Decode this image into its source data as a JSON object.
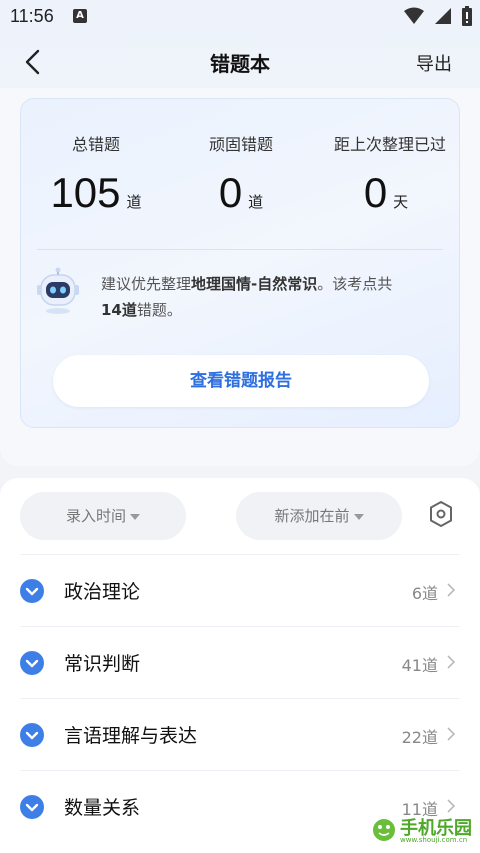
{
  "status_bar": {
    "time": "11:56",
    "a_badge": "A"
  },
  "nav": {
    "title": "错题本",
    "export_label": "导出"
  },
  "summary": {
    "stats": [
      {
        "label": "总错题",
        "value": "105",
        "unit": "道"
      },
      {
        "label": "顽固错题",
        "value": "0",
        "unit": "道"
      },
      {
        "label": "距上次整理已过",
        "value": "0",
        "unit": "天"
      }
    ],
    "suggestion_prefix": "建议优先整理",
    "suggestion_topic": "地理国情-自然常识",
    "suggestion_mid": "。该考点共",
    "suggestion_count": "14道",
    "suggestion_suffix": "错题。",
    "report_button": "查看错题报告"
  },
  "filters": {
    "time_label": "录入时间",
    "order_label": "新添加在前"
  },
  "categories": [
    {
      "name": "政治理论",
      "count": "6道"
    },
    {
      "name": "常识判断",
      "count": "41道"
    },
    {
      "name": "言语理解与表达",
      "count": "22道"
    },
    {
      "name": "数量关系",
      "count": "11道"
    }
  ],
  "watermark": {
    "text": "手机乐园",
    "sub": "www.shouji.com.cn"
  },
  "colors": {
    "accent": "#3d7fe6",
    "report_text": "#2f6fe0"
  },
  "icons": [
    "back-arrow-icon",
    "wifi-icon",
    "signal-icon",
    "battery-icon",
    "robot-icon",
    "settings-hexagon-icon",
    "chevron-down-icon",
    "chevron-right-icon"
  ]
}
